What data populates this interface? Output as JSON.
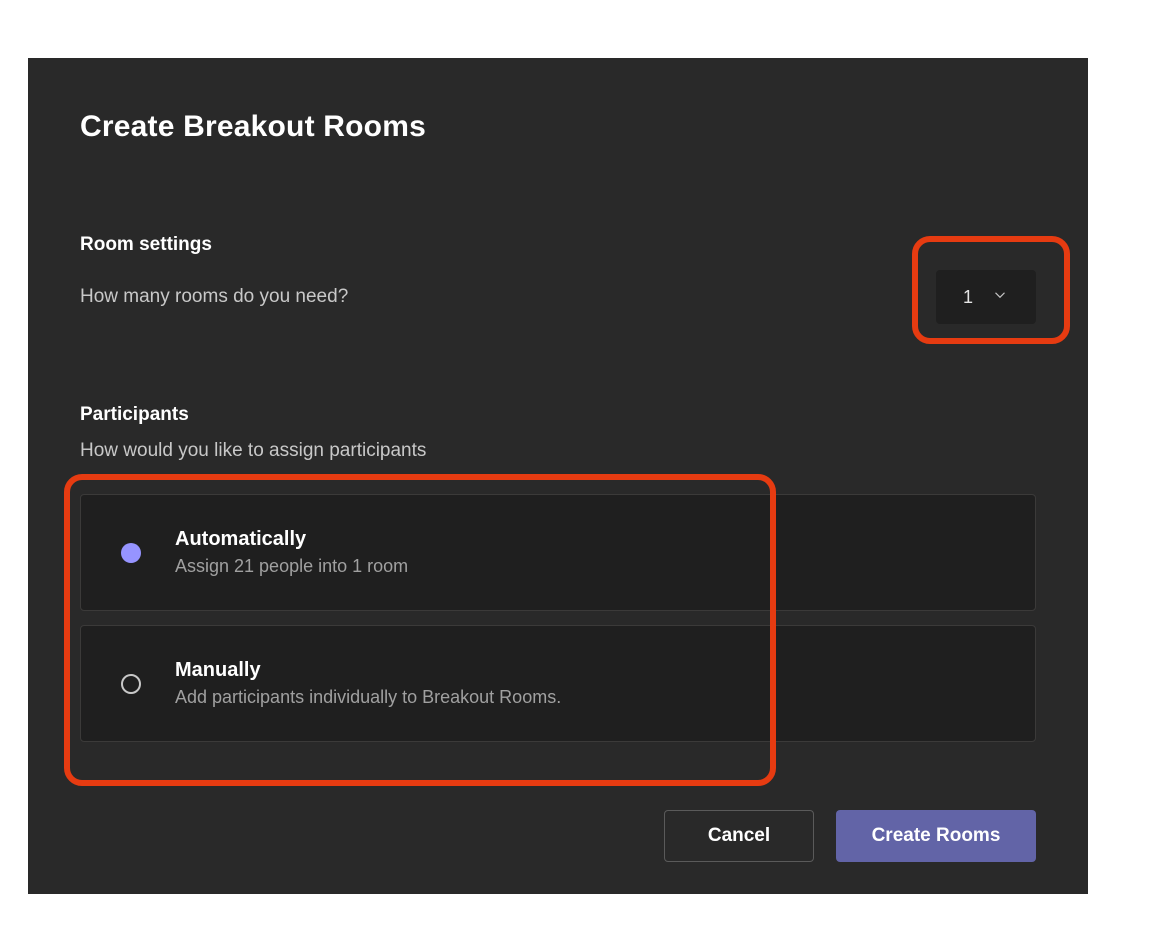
{
  "dialog": {
    "title": "Create Breakout Rooms"
  },
  "room_settings": {
    "heading": "Room settings",
    "question": "How many rooms do you need?",
    "selected_count": "1"
  },
  "participants": {
    "heading": "Participants",
    "question": "How would you like to assign participants",
    "options": [
      {
        "title": "Automatically",
        "subtitle": "Assign 21 people into 1 room",
        "selected": true
      },
      {
        "title": "Manually",
        "subtitle": "Add participants individually to Breakout Rooms.",
        "selected": false
      }
    ]
  },
  "footer": {
    "cancel": "Cancel",
    "create": "Create Rooms"
  },
  "colors": {
    "accent": "#6264a7",
    "radio_selected": "#9694ff",
    "annotation": "#e63b11",
    "panel_bg": "#292929",
    "card_bg": "#1f1f1f"
  }
}
